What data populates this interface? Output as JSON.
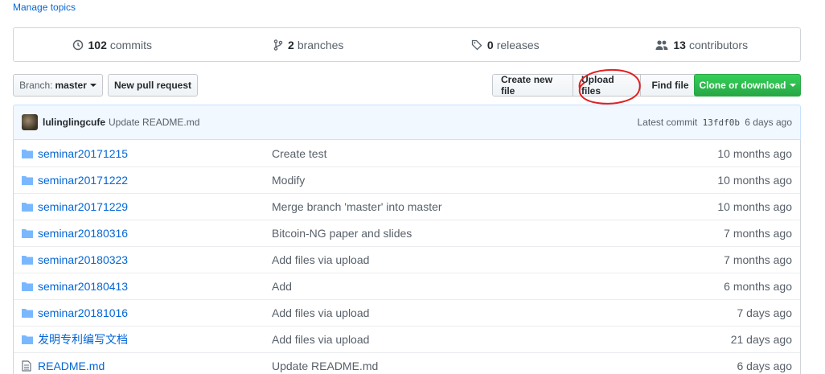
{
  "manage_topics": "Manage topics",
  "stats": {
    "commits": {
      "count": "102",
      "label": "commits"
    },
    "branches": {
      "count": "2",
      "label": "branches"
    },
    "releases": {
      "count": "0",
      "label": "releases"
    },
    "contributors": {
      "count": "13",
      "label": "contributors"
    }
  },
  "toolbar": {
    "branch_prefix": "Branch:",
    "branch_name": "master",
    "new_pr": "New pull request",
    "create_file": "Create new file",
    "upload_files": "Upload files",
    "find_file": "Find file",
    "clone": "Clone or download"
  },
  "commit": {
    "author": "lulinglingcufe",
    "message": "Update README.md",
    "latest_label": "Latest commit",
    "sha": "13fdf0b",
    "age": "6 days ago"
  },
  "files": [
    {
      "name": "seminar20171215",
      "type": "dir",
      "message": "Create test",
      "age": "10 months ago"
    },
    {
      "name": "seminar20171222",
      "type": "dir",
      "message": "Modify",
      "age": "10 months ago"
    },
    {
      "name": "seminar20171229",
      "type": "dir",
      "message": "Merge branch 'master' into master",
      "age": "10 months ago"
    },
    {
      "name": "seminar20180316",
      "type": "dir",
      "message": "Bitcoin-NG paper and slides",
      "age": "7 months ago"
    },
    {
      "name": "seminar20180323",
      "type": "dir",
      "message": "Add files via upload",
      "age": "7 months ago"
    },
    {
      "name": "seminar20180413",
      "type": "dir",
      "message": "Add",
      "age": "6 months ago"
    },
    {
      "name": "seminar20181016",
      "type": "dir",
      "message": "Add files via upload",
      "age": "7 days ago"
    },
    {
      "name": "发明专利编写文档",
      "type": "dir",
      "message": "Add files via upload",
      "age": "21 days ago"
    },
    {
      "name": "README.md",
      "type": "file",
      "message": "Update README.md",
      "age": "6 days ago"
    }
  ],
  "colors": {
    "link": "#0366d6",
    "clone_green": "#28a745",
    "annotation_red": "#e02020"
  }
}
